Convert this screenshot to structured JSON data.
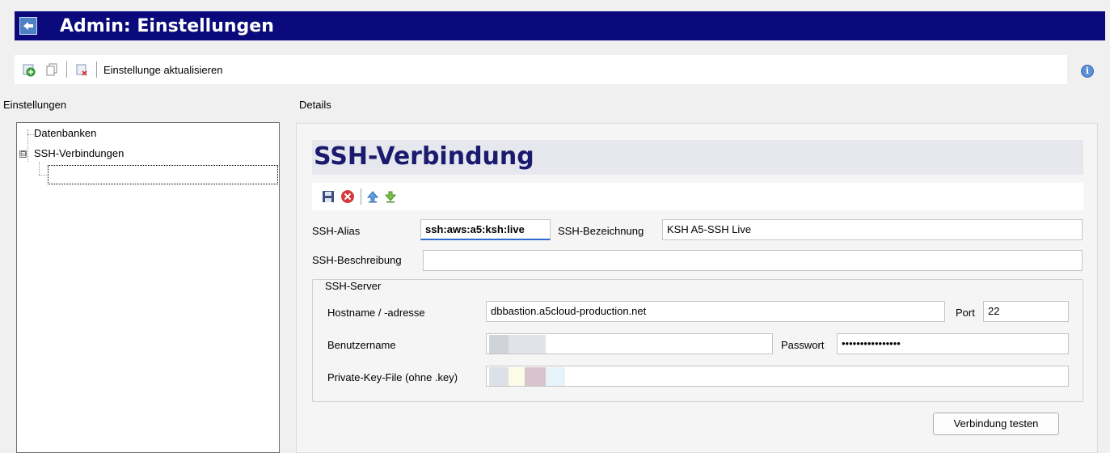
{
  "window": {
    "title": "Admin: Einstellungen"
  },
  "toolbar": {
    "update_label": "Einstellunge aktualisieren",
    "icons": [
      "add-settings-icon",
      "copy-icon",
      "delete-icon"
    ]
  },
  "left_panel": {
    "title": "Einstellungen",
    "tree": {
      "items": [
        {
          "label": "Datenbanken"
        },
        {
          "label": "SSH-Verbindungen",
          "expander": "⊟"
        }
      ]
    }
  },
  "details": {
    "section_label": "Details",
    "header_title": "SSH-Verbindung",
    "form": {
      "alias_label": "SSH-Alias",
      "alias_value": "ssh:aws:a5:ksh:live",
      "name_label": "SSH-Bezeichnung",
      "name_value": "KSH A5-SSH Live",
      "description_label": "SSH-Beschreibung",
      "description_value": ""
    },
    "server_group": {
      "legend": "SSH-Server",
      "hostname_label": "Hostname / -adresse",
      "hostname_value": "dbbastion.a5cloud-production.net",
      "port_label": "Port",
      "port_value": "22",
      "username_label": "Benutzername",
      "password_label": "Passwort",
      "password_value": "••••••••••••••••",
      "keyfile_label": "Private-Key-File (ohne .key)"
    },
    "test_button_label": "Verbindung testen"
  },
  "info_icon": {
    "glyph": "i"
  },
  "colors": {
    "titlebar": "#0a0a7c",
    "header_title": "#1a1a6e",
    "active_field_underline": "#2f6ad0"
  }
}
